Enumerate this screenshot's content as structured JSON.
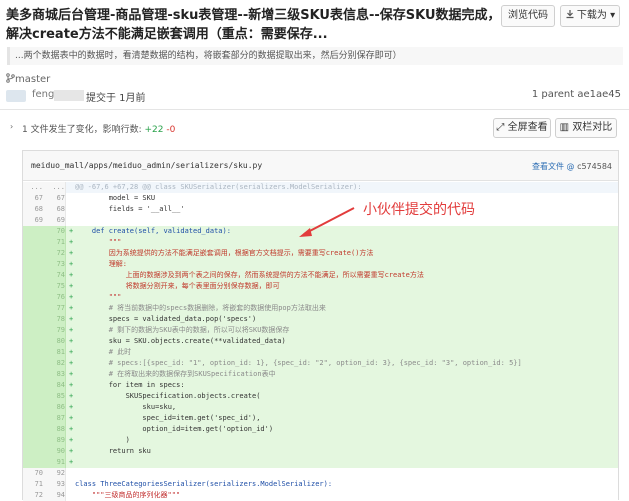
{
  "commit": {
    "title": "美多商城后台管理-商品管理-sku表管理--新增三级SKU表信息--保存SKU数据完成，解决create方法不能满足嵌套调用（重点：需要保存...",
    "description": "...两个数据表中的数据时，看清楚数据的结构，将嵌套部分的数据提取出来，然后分别保存即可）",
    "branch": "master",
    "author": "feng",
    "committed": "提交于 1月前",
    "parent": "1 parent ae1ae45"
  },
  "toolbar": {
    "browse": "浏览代码",
    "download": "下载为",
    "stats_prefix": "1 文件发生了变化，影响行数:",
    "additions": "+22",
    "deletions": "-0",
    "full_view": "全屏查看",
    "split_view": "双栏对比"
  },
  "file": {
    "path": "meiduo_mall/apps/meiduo_admin/serializers/sku.py",
    "view_file": "查看文件",
    "hash": "c574584"
  },
  "annotation": "小伙伴提交的代码",
  "code": {
    "hunk": "@@ -67,6 +67,28 @@ class SKUSerializer(serializers.ModelSerializer):",
    "l67": "        model = SKU",
    "l68": "        fields = '__all__'",
    "l70": "    def create(self, validated_data):",
    "l71": "        \"\"\"",
    "l72": "        因为系统提供的方法不能满足嵌套调用，根据官方文档提示，需要重写create()方法",
    "l73": "        理解:",
    "l74": "            上面的数据涉及到两个表之间的保存，然而系统提供的方法不能满足，所以需要重写create方法",
    "l75": "            将数据分割开来，每个表里面分别保存数据，即可",
    "l76": "        \"\"\"",
    "l77": "        # 将当前数据中的specs数据删除，将嵌套的数据使用pop方法取出来",
    "l78": "        specs = validated_data.pop('specs')",
    "l79": "        # 剩下的数据为SKU表中的数据，所以可以将SKU数据保存",
    "l80": "        sku = SKU.objects.create(**validated_data)",
    "l81": "        # 此时",
    "l82": "        # specs:[{spec_id: \"1\", option_id: 1}, {spec_id: \"2\", option_id: 3}, {spec_id: \"3\", option_id: 5}]",
    "l83": "        # 在将取出来的数据保存到SKUSpecification表中",
    "l84": "        for item in specs:",
    "l85": "            SKUSpecification.objects.create(",
    "l86": "                sku=sku,",
    "l87": "                spec_id=item.get('spec_id'),",
    "l88": "                option_id=item.get('option_id')",
    "l89": "            )",
    "l90": "        return sku",
    "l93": "class ThreeCategoriesSerializer(serializers.ModelSerializer):",
    "l94": "    \"\"\"三级商品的序列化器\"\"\""
  }
}
